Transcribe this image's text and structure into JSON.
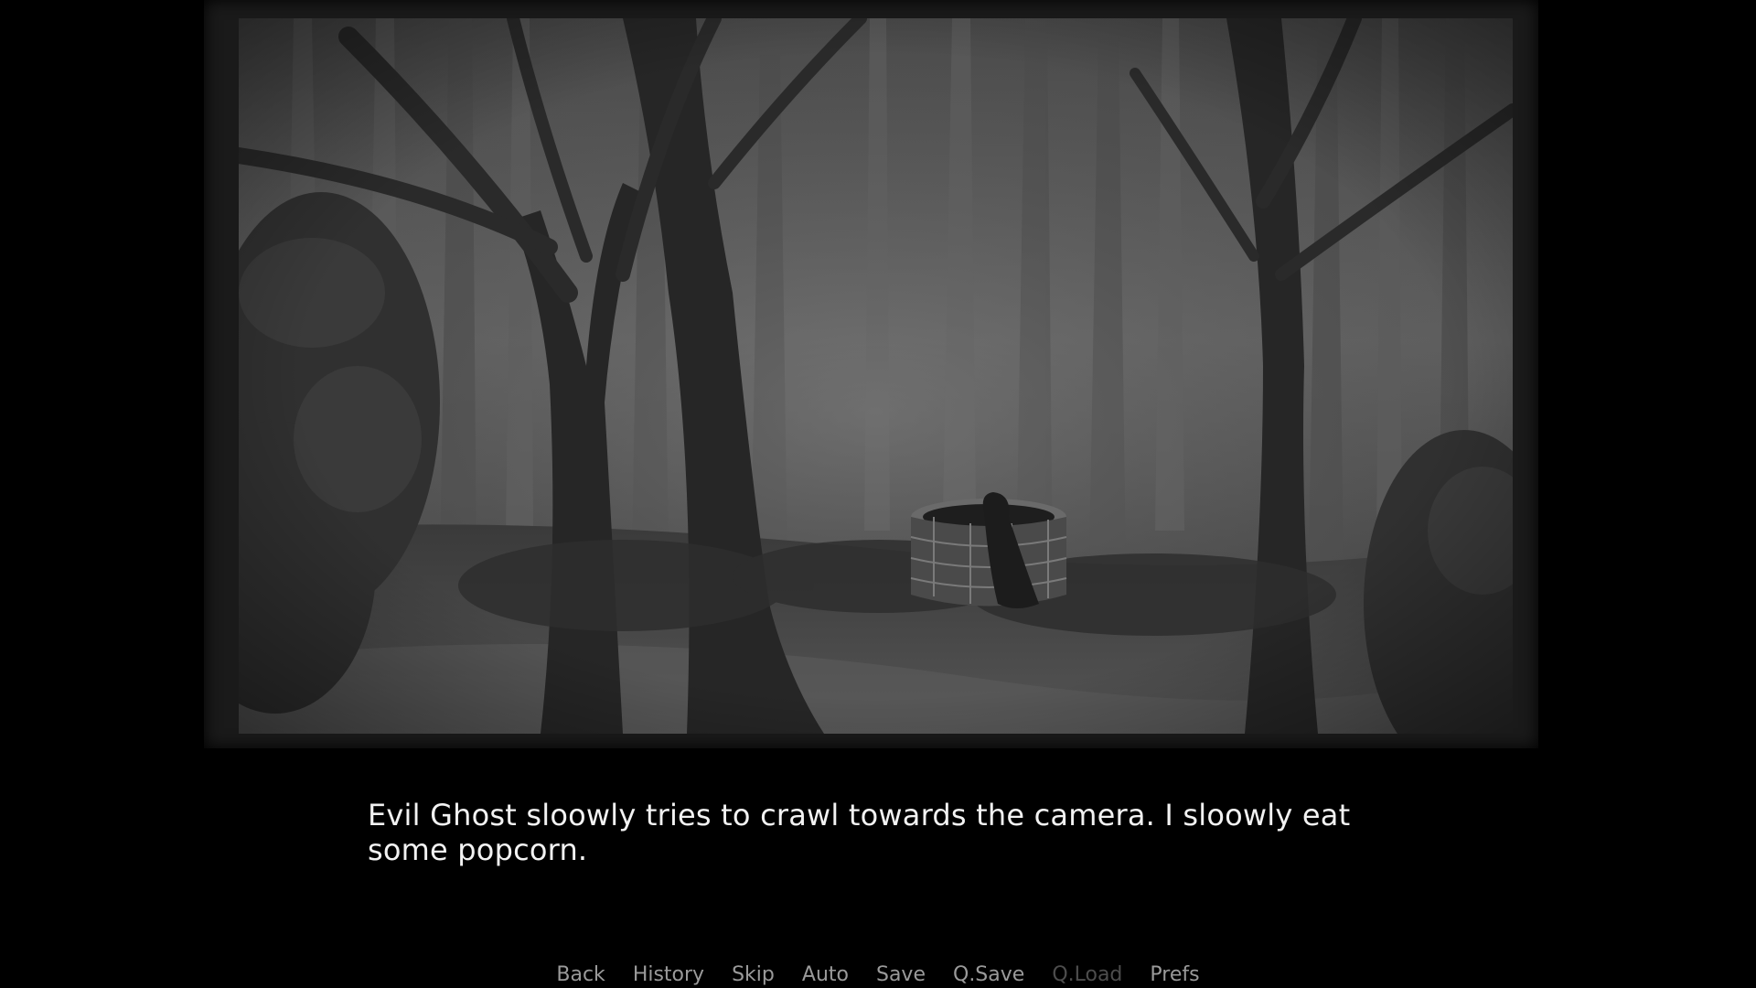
{
  "scene": {
    "description_icon": "haunted-forest-with-well-and-ghost"
  },
  "dialogue": {
    "text": "Evil Ghost sloowly tries to crawl towards the camera. I sloowly eat some popcorn."
  },
  "quick_menu": {
    "back": "Back",
    "history": "History",
    "skip": "Skip",
    "auto": "Auto",
    "save": "Save",
    "qsave": "Q.Save",
    "qload": "Q.Load",
    "prefs": "Prefs"
  },
  "colors": {
    "background": "#000000",
    "text": "#f2f2f2",
    "menu_text": "#9a9a9a",
    "menu_disabled": "#4d4d4d"
  }
}
